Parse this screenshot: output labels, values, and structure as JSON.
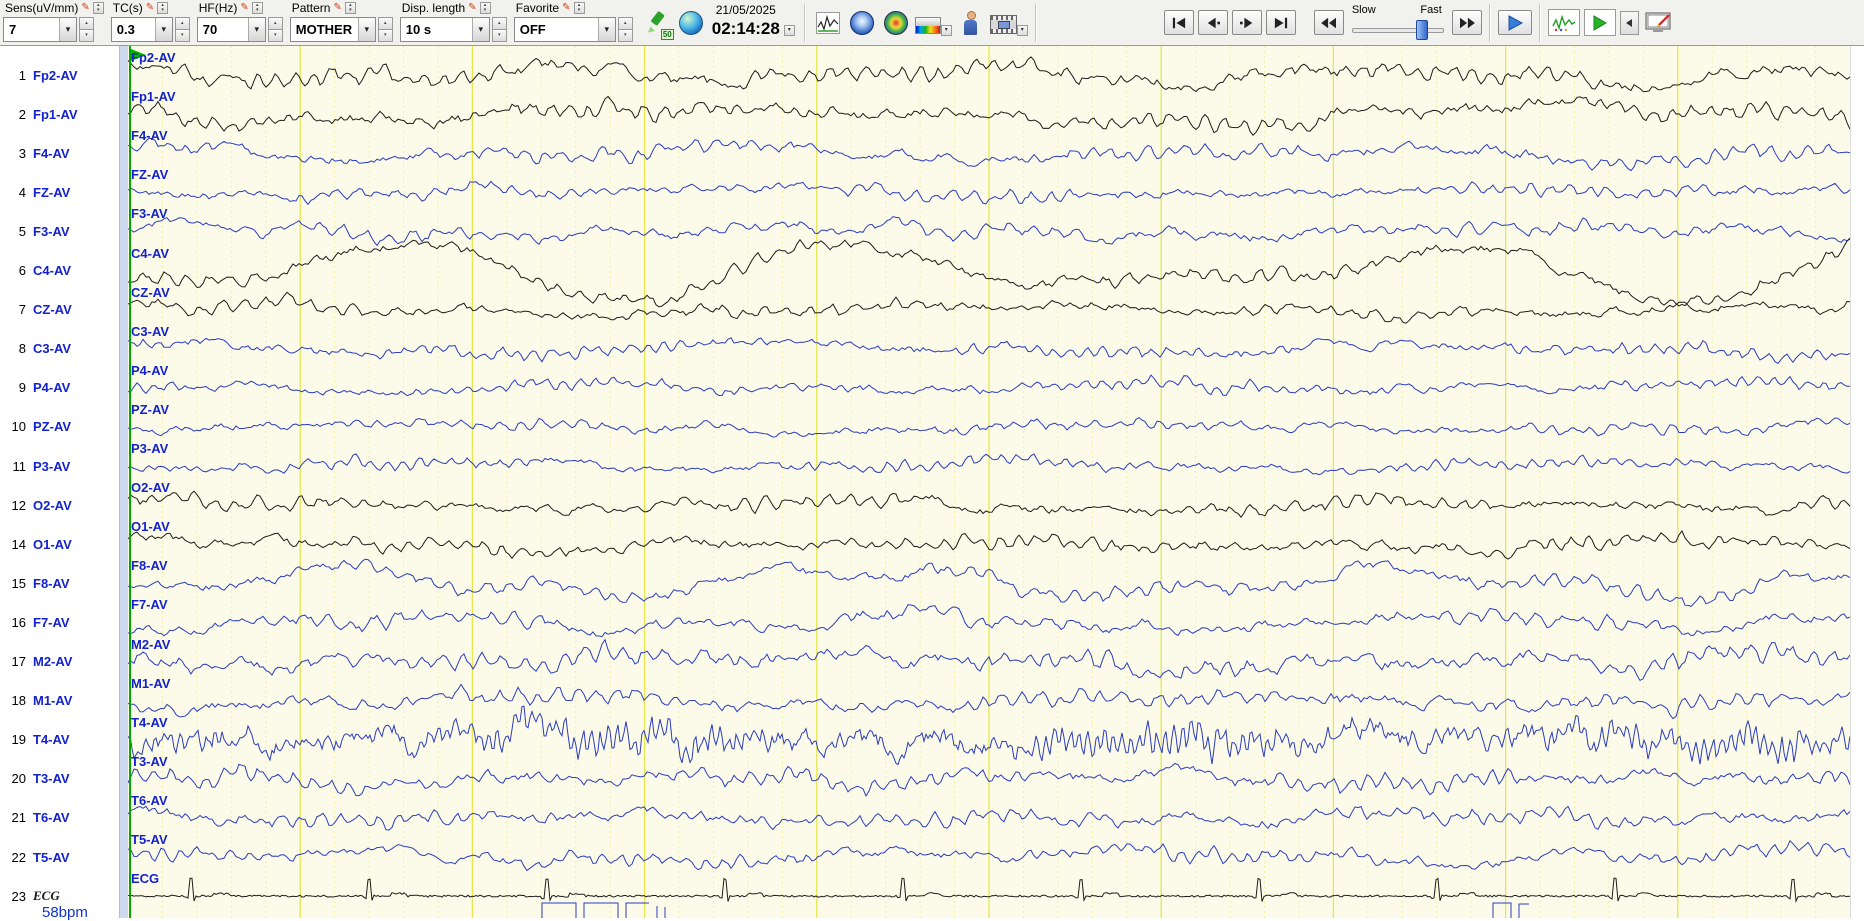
{
  "toolbar": {
    "controls": [
      {
        "label": "Sens(uV/mm)",
        "value": "7"
      },
      {
        "label": "TC(s)",
        "value": "0.3"
      },
      {
        "label": "HF(Hz)",
        "value": "70"
      },
      {
        "label": "Pattern",
        "value": "MOTHER"
      },
      {
        "label": "Disp. length",
        "value": "10 s"
      },
      {
        "label": "Favorite",
        "value": "OFF"
      }
    ],
    "overlay_badge": "50",
    "date": "21/05/2025",
    "time": "02:14:28",
    "slider": {
      "left_label": "Slow",
      "right_label": "Fast"
    }
  },
  "icons": {
    "caret_down": "▾",
    "caret_up": "▴",
    "pen": "✎"
  },
  "plot": {
    "seconds": 10,
    "colors": {
      "blue_trace": "#2a3cbe",
      "black_trace": "#1c1c1c",
      "grid_major": "#e7e64f",
      "grid_minor": "#f0efa2",
      "background": "#fcfbea",
      "cursor_green": "#00a800",
      "label_blue": "#1322cc"
    }
  },
  "channels": [
    {
      "num": "1",
      "label": "Fp2-AV",
      "color": "black",
      "amp": 6,
      "slow": 9
    },
    {
      "num": "2",
      "label": "Fp1-AV",
      "color": "black",
      "amp": 6,
      "slow": 10
    },
    {
      "num": "3",
      "label": "F4-AV",
      "color": "blue",
      "amp": 5,
      "slow": 6
    },
    {
      "num": "4",
      "label": "FZ-AV",
      "color": "blue",
      "amp": 4.5,
      "slow": 5
    },
    {
      "num": "5",
      "label": "F3-AV",
      "color": "blue",
      "amp": 5,
      "slow": 6
    },
    {
      "num": "6",
      "label": "C4-AV",
      "color": "black",
      "amp": 5,
      "slow": 28
    },
    {
      "num": "7",
      "label": "CZ-AV",
      "color": "black",
      "amp": 4.5,
      "slow": 6
    },
    {
      "num": "8",
      "label": "C3-AV",
      "color": "blue",
      "amp": 4.5,
      "slow": 5
    },
    {
      "num": "9",
      "label": "P4-AV",
      "color": "blue",
      "amp": 4,
      "slow": 4
    },
    {
      "num": "10",
      "label": "PZ-AV",
      "color": "blue",
      "amp": 4,
      "slow": 4
    },
    {
      "num": "11",
      "label": "P3-AV",
      "color": "blue",
      "amp": 4,
      "slow": 4
    },
    {
      "num": "12",
      "label": "O2-AV",
      "color": "black",
      "amp": 5,
      "slow": 5
    },
    {
      "num": "14",
      "label": "O1-AV",
      "color": "black",
      "amp": 5,
      "slow": 5
    },
    {
      "num": "15",
      "label": "F8-AV",
      "color": "blue",
      "amp": 5,
      "slow": 15
    },
    {
      "num": "16",
      "label": "F7-AV",
      "color": "blue",
      "amp": 5.5,
      "slow": 7
    },
    {
      "num": "17",
      "label": "M2-AV",
      "color": "blue",
      "amp": 7,
      "slow": 8
    },
    {
      "num": "18",
      "label": "M1-AV",
      "color": "blue",
      "amp": 6,
      "slow": 6
    },
    {
      "num": "19",
      "label": "T4-AV",
      "color": "blue",
      "amp": 11,
      "slow": 5,
      "hf": true
    },
    {
      "num": "20",
      "label": "T3-AV",
      "color": "blue",
      "amp": 6,
      "slow": 5
    },
    {
      "num": "21",
      "label": "T6-AV",
      "color": "blue",
      "amp": 5.5,
      "slow": 5
    },
    {
      "num": "22",
      "label": "T5-AV",
      "color": "blue",
      "amp": 5,
      "slow": 5
    },
    {
      "num": "23",
      "label": "ECG",
      "color": "black",
      "amp": 1,
      "slow": 0,
      "kind": "ecg"
    }
  ],
  "heart_rate": "58bpm"
}
